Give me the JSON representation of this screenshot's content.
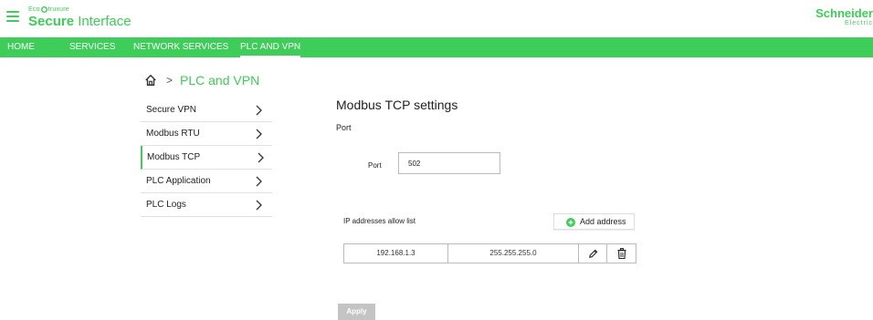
{
  "header": {
    "brand_prefix_left": "Eco",
    "brand_prefix_right": "truxure",
    "brand_title_bold": "Secure",
    "brand_title_rest": " Interface",
    "vendor_name": "Schneider",
    "vendor_sub": "Electric",
    "accent_color": "#3dcd58"
  },
  "nav": {
    "tabs": [
      {
        "label": "HOME",
        "active": false
      },
      {
        "label": "SERVICES",
        "active": false
      },
      {
        "label": "NETWORK SERVICES",
        "active": false
      },
      {
        "label": "PLC AND VPN",
        "active": true
      }
    ]
  },
  "breadcrumb": {
    "home_icon": "home-icon",
    "separator": ">",
    "current": "PLC and VPN"
  },
  "sidebar": {
    "items": [
      {
        "label": "Secure VPN",
        "active": false,
        "icon": "chevron-right-icon"
      },
      {
        "label": "Modbus RTU",
        "active": false,
        "icon": "chevron-right-icon"
      },
      {
        "label": "Modbus TCP",
        "active": true,
        "icon": "chevron-right-icon"
      },
      {
        "label": "PLC Application",
        "active": false,
        "icon": "chevron-right-icon"
      },
      {
        "label": "PLC Logs",
        "active": false,
        "icon": "chevron-right-icon"
      }
    ]
  },
  "main": {
    "title": "Modbus TCP settings",
    "port_section_label": "Port",
    "port_field_label": "Port",
    "port_value": "502",
    "allow_list_label": "IP addresses allow list",
    "add_address_label": "Add address",
    "allow_list": [
      {
        "ip": "192.168.1.3",
        "mask": "255.255.255.0"
      }
    ],
    "apply_label": "Apply"
  }
}
